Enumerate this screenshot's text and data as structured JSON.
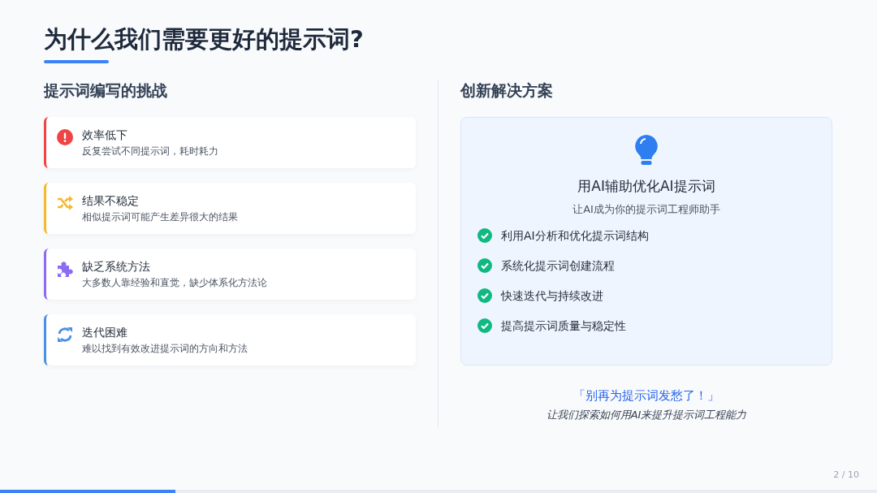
{
  "title": "为什么我们需要更好的提示词?",
  "challenges": {
    "heading": "提示词编写的挑战",
    "items": [
      {
        "kind": "alert",
        "color": "#ef4444",
        "title": "效率低下",
        "text": "反复尝试不同提示词，耗时耗力"
      },
      {
        "kind": "shuffle",
        "color": "#f5b82e",
        "title": "结果不稳定",
        "text": "相似提示词可能产生差异很大的结果"
      },
      {
        "kind": "puzzle",
        "color": "#8b6cf0",
        "title": "缺乏系统方法",
        "text": "大多数人靠经验和直觉，缺少体系化方法论"
      },
      {
        "kind": "sync",
        "color": "#4a90e2",
        "title": "迭代困难",
        "text": "难以找到有效改进提示词的方向和方法"
      }
    ]
  },
  "solution": {
    "heading": "创新解决方案",
    "card_title": "用AI辅助优化AI提示词",
    "card_subtitle": "让AI成为你的提示词工程师助手",
    "points": [
      "利用AI分析和优化提示词结构",
      "系统化提示词创建流程",
      "快速迭代与持续改进",
      "提高提示词质量与稳定性"
    ],
    "quote": "「别再为提示词发愁了！」",
    "tagline": "让我们探索如何用AI来提升提示词工程能力"
  },
  "page_number": "2 / 10",
  "progress": {
    "level": 0.2
  }
}
